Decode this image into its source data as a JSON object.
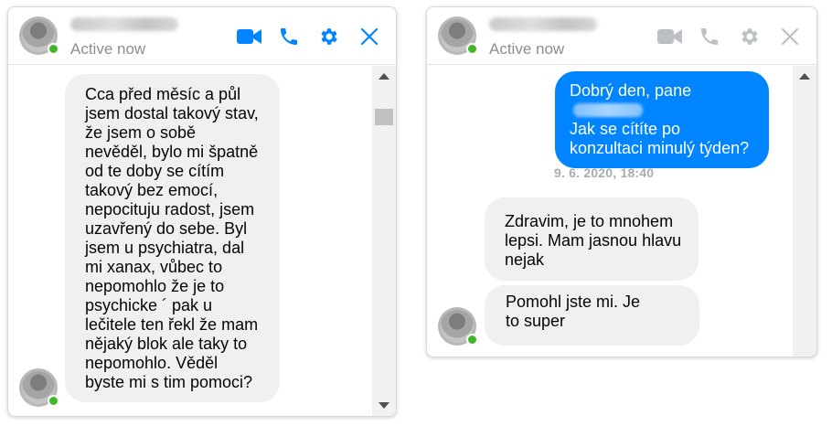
{
  "colors": {
    "accent": "#0084ff",
    "presence": "#42b72a",
    "incoming_bubble": "#f0f0f0",
    "muted_icon": "#bcc0c4"
  },
  "chat_left": {
    "status": "Active now",
    "header_icons": [
      "video-camera-icon",
      "phone-icon",
      "gear-icon",
      "close-icon"
    ],
    "messages": [
      {
        "direction": "incoming",
        "lines": [
          "Cca před měsíc a půl",
          "jsem dostal takový stav,",
          "že jsem o sobě",
          "nevěděl, bylo mi špatně",
          "od te doby se cítím",
          "takový bez emocí,",
          "nepocituju radost, jsem",
          "uzavřený do sebe. Byl",
          "jsem u psychiatra, dal",
          "mi xanax, vůbec to",
          "nepomohlo že je to",
          "psychicke ´ pak u",
          "lečitele ten řekl že mam",
          "nějaký blok ale taky to",
          "nepomohlo. Věděl",
          "byste mi s tim pomoci?"
        ]
      }
    ]
  },
  "chat_right": {
    "status": "Active now",
    "header_icons": [
      "video-camera-icon",
      "phone-icon",
      "gear-icon",
      "close-icon"
    ],
    "outgoing": {
      "line1_prefix": "Dobrý den, pane",
      "line2": "Jak se cítíte po",
      "line3": "konzultaci minulý týden?"
    },
    "timestamp": "9. 6. 2020, 18:40",
    "incoming": [
      {
        "lines": [
          "Zdravim, je to mnohem",
          "lepsi. Mam jasnou hlavu",
          "nejak"
        ]
      },
      {
        "lines": [
          "Pomohl jste mi. Je",
          "to super"
        ]
      }
    ]
  }
}
